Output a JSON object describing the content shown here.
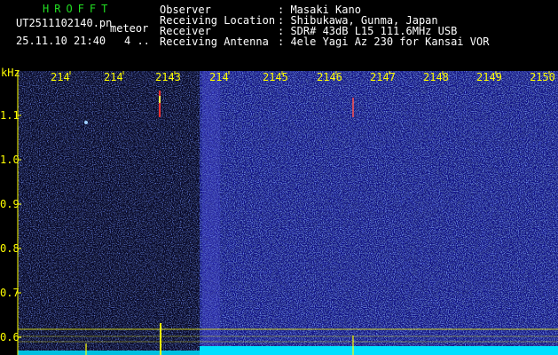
{
  "header": {
    "brand": "HROFFT",
    "filename": "UT2511102140.pn",
    "mode": "meteor",
    "datetime": "25.11.10 21:40",
    "count": "4 .."
  },
  "info": {
    "labels": [
      "Observer",
      "Receiving Location",
      "Receiver",
      "Receiving Antenna"
    ],
    "values": [
      ": Masaki Kano",
      ": Shibukawa, Gunma, Japan",
      ": SDR# 43dB L15 111.6MHz USB",
      ": 4ele Yagi Az 230 for Kansai VOR"
    ]
  },
  "spectrogram": {
    "y_unit": "kHz",
    "x_ticks": [
      "214",
      "214",
      "2143",
      "214",
      "2145",
      "2146",
      "2147",
      "2148",
      "2149",
      "2150"
    ],
    "y_ticks": [
      "1.1",
      "1.0",
      "0.9",
      "0.8",
      "0.7",
      "0.6"
    ],
    "colors": {
      "background": "#000000",
      "noise_dark": "#0a0a2a",
      "noise_bright": "#1414a0",
      "text": "#ffff00",
      "trace": "#00ffff"
    }
  }
}
